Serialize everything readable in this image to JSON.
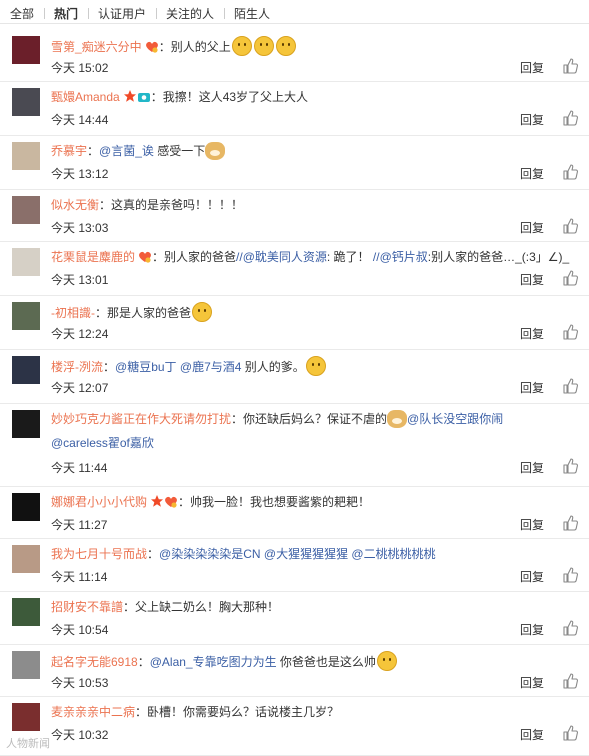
{
  "tabs": [
    "全部",
    "热门",
    "认证用户",
    "关注的人",
    "陌生人"
  ],
  "reply_label": "回复",
  "watermark": "人物新闻",
  "comments": [
    {
      "user": "雪第_痴迷六分中",
      "badge": "vip-heart-icon",
      "segs": [
        {
          "t": "：别人的父上",
          "c": "t"
        }
      ],
      "emo": [
        "grin-icon",
        "grin-icon",
        "grin-icon"
      ],
      "time": "今天 15:02"
    },
    {
      "user": "甄嬛Amanda",
      "badge": "star-camera-icon",
      "segs": [
        {
          "t": "：我擦！这人43岁了父上大人",
          "c": "t"
        }
      ],
      "emo": [],
      "time": "今天 14:44"
    },
    {
      "user": "乔慕宇",
      "segs": [
        {
          "t": "：",
          "c": "t"
        },
        {
          "t": "@言菌_诶",
          "c": "m"
        },
        {
          "t": " 感受一下",
          "c": "t"
        }
      ],
      "emo": [
        "dog-icon"
      ],
      "time": "今天 13:12"
    },
    {
      "user": "似水无衡",
      "segs": [
        {
          "t": "：这真的是亲爸吗！！！！",
          "c": "t"
        }
      ],
      "emo": [],
      "time": "今天 13:03"
    },
    {
      "user": "花栗鼠是麋鹿的",
      "badge": "vip-heart-icon",
      "segs": [
        {
          "t": "：别人家的爸爸",
          "c": "t"
        },
        {
          "t": "//@耽美同人资源",
          "c": "m"
        },
        {
          "t": ": 跪了！ ",
          "c": "t"
        },
        {
          "t": "//@钙片叔",
          "c": "m"
        },
        {
          "t": ":别人家的爸爸…_(:3」∠)_",
          "c": "t"
        }
      ],
      "emo": [],
      "time": "今天 13:01"
    },
    {
      "user": "-初相識-",
      "segs": [
        {
          "t": "：那是人家的爸爸",
          "c": "t"
        }
      ],
      "emo": [
        "laugh-icon"
      ],
      "time": "今天 12:24"
    },
    {
      "user": "楼浮-洌流",
      "segs": [
        {
          "t": "：",
          "c": "t"
        },
        {
          "t": "@糖豆bu丁",
          "c": "m"
        },
        {
          "t": " ",
          "c": "t"
        },
        {
          "t": "@鹿7与酒4",
          "c": "m"
        },
        {
          "t": " 别人的爹。",
          "c": "t"
        }
      ],
      "emo": [
        "speechless-icon"
      ],
      "time": "今天 12:07"
    },
    {
      "user": "妙妙巧克力酱正在作大死请勿打扰",
      "segs": [
        {
          "t": "：你还缺后妈么？保证不虐的",
          "c": "t"
        }
      ],
      "emo": [
        "dog-icon"
      ],
      "segs2": [
        {
          "t": "@队长没空跟你闹",
          "c": "m"
        }
      ],
      "line1b": [
        {
          "t": "@careless翟of嘉欣",
          "c": "m"
        }
      ],
      "time": "今天 11:44"
    },
    {
      "user": "娜娜君小小小代购",
      "badge": "star-heart-icon",
      "segs": [
        {
          "t": "：帅我一脸！我也想要酱紫的耙耙！",
          "c": "t"
        }
      ],
      "emo": [],
      "time": "今天 11:27"
    },
    {
      "user": "我为七月十号而战",
      "segs": [
        {
          "t": "：",
          "c": "t"
        },
        {
          "t": "@染染染染染是CN",
          "c": "m"
        },
        {
          "t": " ",
          "c": "t"
        },
        {
          "t": "@大猩猩猩猩猩",
          "c": "m"
        },
        {
          "t": " ",
          "c": "t"
        },
        {
          "t": "@二桃桃桃桃桃",
          "c": "m"
        }
      ],
      "emo": [],
      "time": "今天 11:14"
    },
    {
      "user": "招财安不靠譜",
      "segs": [
        {
          "t": "：父上缺二奶么！胸大那种！",
          "c": "t"
        }
      ],
      "emo": [],
      "time": "今天 10:54"
    },
    {
      "user": "起名字无能6918",
      "segs": [
        {
          "t": "：",
          "c": "t"
        },
        {
          "t": "@Alan_专靠吃图力为生",
          "c": "m"
        },
        {
          "t": " 你爸爸也是这么帅",
          "c": "t"
        }
      ],
      "emo": [
        "drool-icon"
      ],
      "time": "今天 10:53"
    },
    {
      "user": "麦亲亲亲中二病",
      "segs": [
        {
          "t": "：卧槽！你需要妈么？话说楼主几岁？",
          "c": "t"
        }
      ],
      "emo": [],
      "time": "今天 10:32"
    }
  ],
  "avatar_colors": [
    "#6b1f2a",
    "#4a4a52",
    "#c9b7a0",
    "#8a6f6a",
    "#d6d0c6",
    "#5c6a52",
    "#2c3346",
    "#1a1a1a",
    "#111111",
    "#b89a86",
    "#3d5a3a",
    "#8c8c8c",
    "#7a2e2e"
  ]
}
